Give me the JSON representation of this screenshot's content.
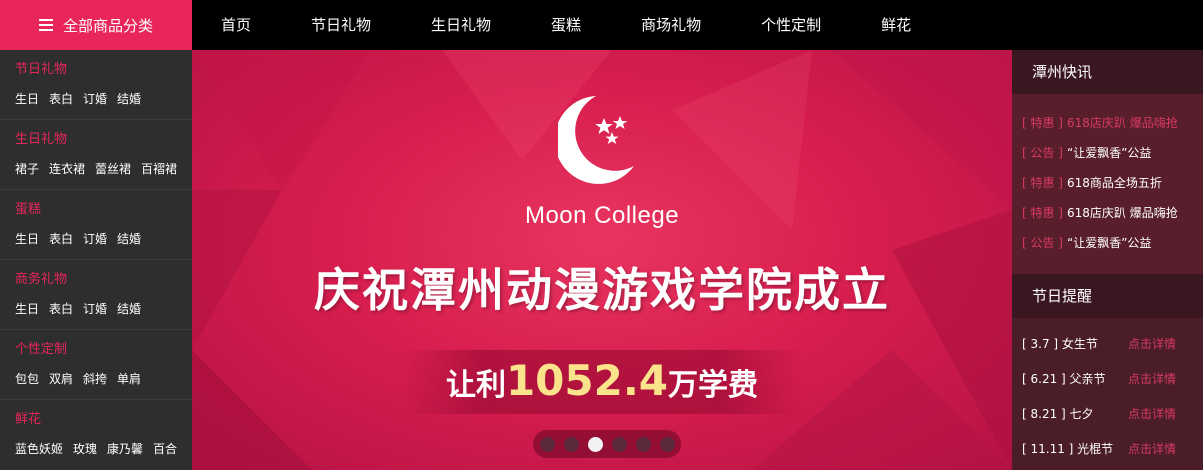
{
  "header": {
    "all_categories_label": "全部商品分类",
    "nav": [
      "首页",
      "节日礼物",
      "生日礼物",
      "蛋糕",
      "商场礼物",
      "个性定制",
      "鲜花"
    ]
  },
  "sidebar": {
    "categories": [
      {
        "title": "节日礼物",
        "items": [
          "生日",
          "表白",
          "订婚",
          "结婚"
        ]
      },
      {
        "title": "生日礼物",
        "items": [
          "裙子",
          "连衣裙",
          "蕾丝裙",
          "百褶裙"
        ]
      },
      {
        "title": "蛋糕",
        "items": [
          "生日",
          "表白",
          "订婚",
          "结婚"
        ]
      },
      {
        "title": "商务礼物",
        "items": [
          "生日",
          "表白",
          "订婚",
          "结婚"
        ]
      },
      {
        "title": "个性定制",
        "items": [
          "包包",
          "双肩",
          "斜挎",
          "单肩"
        ]
      },
      {
        "title": "鲜花",
        "items": [
          "蓝色妖姬",
          "玫瑰",
          "康乃馨",
          "百合"
        ]
      }
    ]
  },
  "banner": {
    "college_name": "Moon College",
    "headline": "庆祝潭州动漫游戏学院成立",
    "sub_prefix": "让利",
    "sub_number": "1052.4",
    "sub_suffix": "万学费",
    "slide_count": 6,
    "active_slide": 3
  },
  "news": {
    "title": "潭州快讯",
    "items": [
      {
        "tag": "[ 特惠 ]",
        "text": "618店庆趴 爆品嗨抢",
        "dim": true
      },
      {
        "tag": "[ 公告 ]",
        "text": "“让爱飘香”公益",
        "dim": false
      },
      {
        "tag": "[ 特惠 ]",
        "text": "618商品全场五折",
        "dim": false
      },
      {
        "tag": "[ 特惠 ]",
        "text": "618店庆趴 爆品嗨抢",
        "dim": false
      },
      {
        "tag": "[ 公告 ]",
        "text": "“让爱飘香”公益",
        "dim": false
      }
    ]
  },
  "festivals": {
    "title": "节日提醒",
    "items": [
      {
        "name": "[ 3.7 ] 女生节",
        "link": "点击详情"
      },
      {
        "name": "[ 6.21 ] 父亲节",
        "link": "点击详情"
      },
      {
        "name": "[ 8.21 ] 七夕",
        "link": "点击详情"
      },
      {
        "name": "[ 11.11 ] 光棍节",
        "link": "点击详情"
      }
    ]
  },
  "colors": {
    "accent": "#e8265a",
    "highlight_number": "#fbe38c"
  }
}
